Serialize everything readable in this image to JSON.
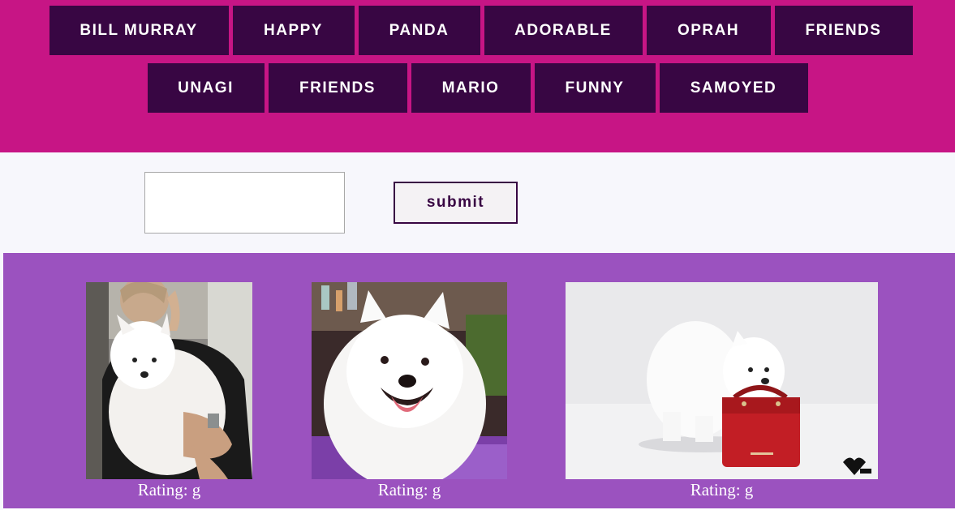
{
  "topics": {
    "row1": [
      "BILL MURRAY",
      "HAPPY",
      "PANDA",
      "ADORABLE",
      "OPRAH",
      "FRIENDS"
    ],
    "row2": [
      "UNAGI",
      "FRIENDS",
      "MARIO",
      "FUNNY",
      "SAMOYED"
    ]
  },
  "form": {
    "search_value": "",
    "submit_label": "submit"
  },
  "gifs": [
    {
      "subject": "woman holding white samoyed puppy",
      "rating": "Rating: g"
    },
    {
      "subject": "smiling samoyed at dog show",
      "rating": "Rating: g"
    },
    {
      "subject": "samoyed puppy carrying red handbag",
      "rating": "Rating: g"
    }
  ],
  "colors": {
    "header_bg": "#c71585",
    "button_bg": "#380643",
    "gif_area_bg": "#9b52bf",
    "page_bg": "#f7f7fc"
  }
}
